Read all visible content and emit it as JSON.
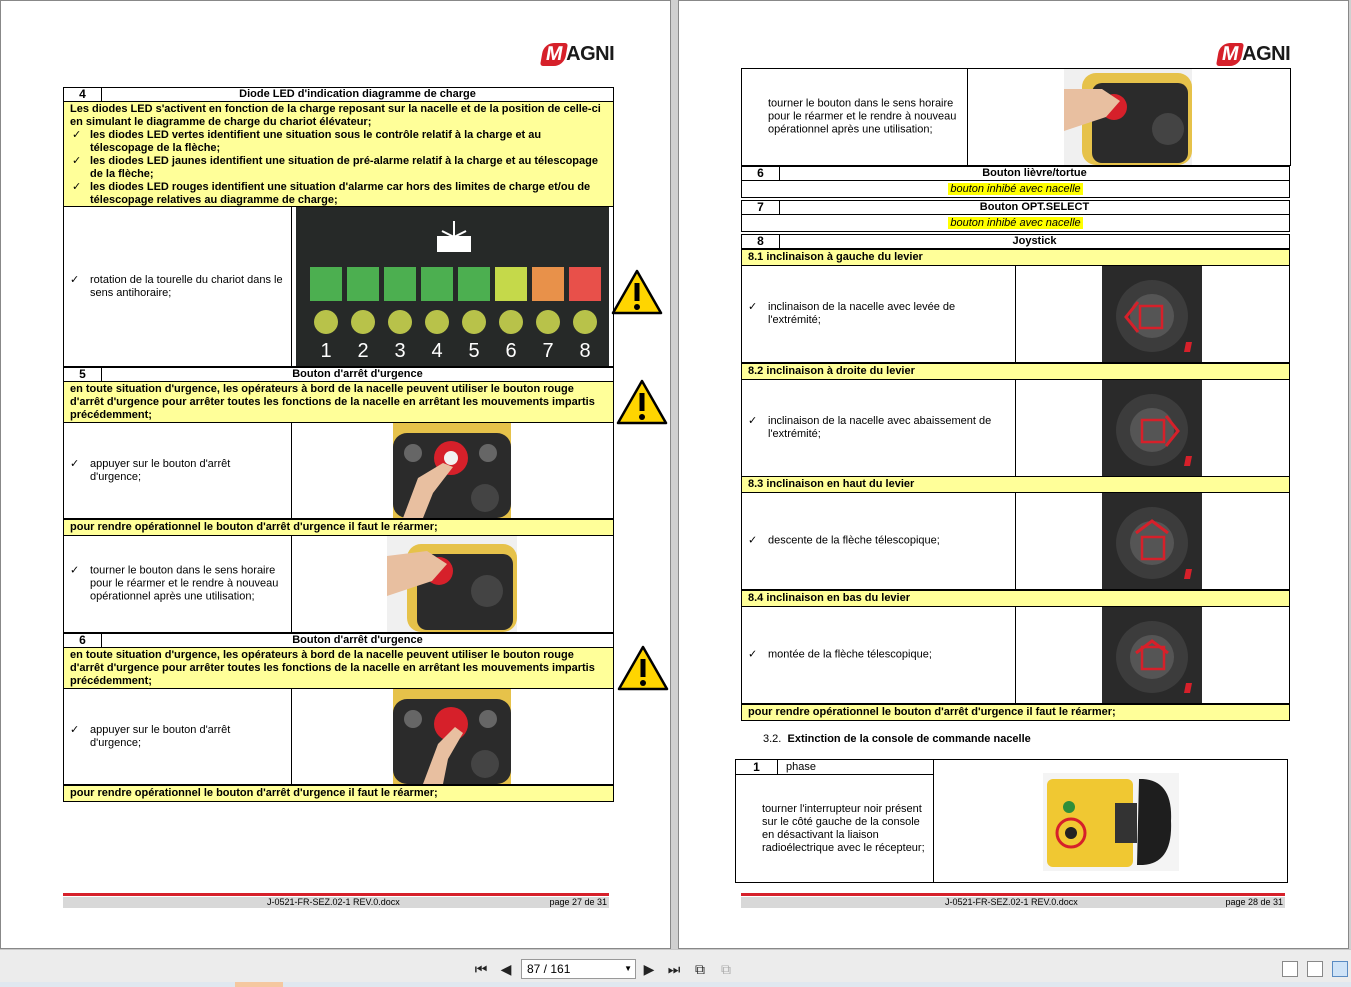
{
  "brand": {
    "logo_m": "M",
    "logo_rest": "AGNI"
  },
  "left_page": {
    "sec4": {
      "num": "4",
      "title": "Diode LED d'indication diagramme de charge",
      "intro": "Les diodes LED s'activent en fonction de la charge reposant sur la nacelle et de la position de celle-ci en simulant le diagramme de charge du chariot élévateur;",
      "bullets": [
        "les diodes LED vertes identifient une situation sous le contrôle relatif à la charge et au télescopage de la flèche;",
        "les diodes LED jaunes identifient une situation de pré-alarme relatif à la charge et au télescopage de la flèche;",
        "les diodes LED rouges identifient une situation d'alarme car hors des limites de charge et/ou de télescopage relatives au diagramme de charge;"
      ],
      "row_text": "rotation de la tourelle du chariot dans le sens antihoraire;",
      "led_numbers": [
        "1",
        "2",
        "3",
        "4",
        "5",
        "6",
        "7",
        "8"
      ],
      "led_colors": [
        "#4caf50",
        "#4caf50",
        "#4caf50",
        "#4caf50",
        "#4caf50",
        "#c5d94a",
        "#e8914a",
        "#e8504a"
      ]
    },
    "sec5": {
      "num": "5",
      "title": "Bouton d'arrêt d'urgence",
      "intro": "en toute situation d'urgence, les opérateurs à bord de la nacelle peuvent utiliser le bouton rouge d'arrêt d'urgence pour arrêter toutes les fonctions de la nacelle en arrêtant les mouvements impartis précédemment;",
      "row1_text": "appuyer sur le bouton d'arrêt d'urgence;",
      "rearm_text": "pour rendre opérationnel le bouton d'arrêt d'urgence il faut le réarmer;",
      "row2_text": "tourner le bouton dans le sens horaire pour le réarmer et le rendre à nouveau opérationnel après une utilisation;"
    },
    "sec6": {
      "num": "6",
      "title": "Bouton d'arrêt d'urgence",
      "intro": "en toute situation d'urgence, les opérateurs à bord de la nacelle peuvent utiliser le bouton rouge d'arrêt d'urgence pour arrêter toutes les fonctions de la nacelle en arrêtant les mouvements impartis précédemment;",
      "row_text": "appuyer sur le bouton d'arrêt d'urgence;",
      "rearm_text": "pour rendre opérationnel le bouton d'arrêt d'urgence il faut le réarmer;"
    },
    "footer": {
      "doc": "J-0521-FR-SEZ.02-1 REV.0.docx",
      "page": "page 27 de 31"
    }
  },
  "right_page": {
    "top_row_text": "tourner le bouton dans le sens horaire pour le réarmer et le rendre à nouveau opérationnel après une utilisation;",
    "sec6": {
      "num": "6",
      "title": "Bouton lièvre/tortue",
      "note": "bouton inhibé avec nacelle"
    },
    "sec7": {
      "num": "7",
      "title": "Bouton OPT.SELECT",
      "note": "bouton inhibé avec nacelle"
    },
    "sec8": {
      "num": "8",
      "title": "Joystick",
      "items": [
        {
          "label": "8.1   inclinaison à gauche du levier",
          "text": "inclinaison de la nacelle avec levée de l'extrémité;"
        },
        {
          "label": "8.2   inclinaison à droite du levier",
          "text": "inclinaison de la nacelle avec abaissement de l'extrémité;"
        },
        {
          "label": "8.3   inclinaison en haut du levier",
          "text": "descente de la flèche télescopique;"
        },
        {
          "label": "8.4   inclinaison en bas du levier",
          "text": "montée de la flèche télescopique;"
        }
      ],
      "rearm_text": "pour rendre opérationnel le bouton d'arrêt d'urgence il faut le réarmer;"
    },
    "sec32": {
      "heading_num": "3.2.",
      "heading": "Extinction de la console de commande nacelle",
      "num": "1",
      "phase": "phase",
      "row_text": "tourner l'interrupteur noir présent sur le côté gauche de la console en désactivant la liaison radioélectrique avec le récepteur;"
    },
    "footer": {
      "doc": "J-0521-FR-SEZ.02-1 REV.0.docx",
      "page": "page 28 de 31"
    }
  },
  "toolbar": {
    "page_value": "87 / 161",
    "icons": [
      "first-page-icon",
      "prev-page-icon",
      "next-page-icon",
      "last-page-icon",
      "fit-page-icon",
      "fit-width-icon"
    ]
  }
}
